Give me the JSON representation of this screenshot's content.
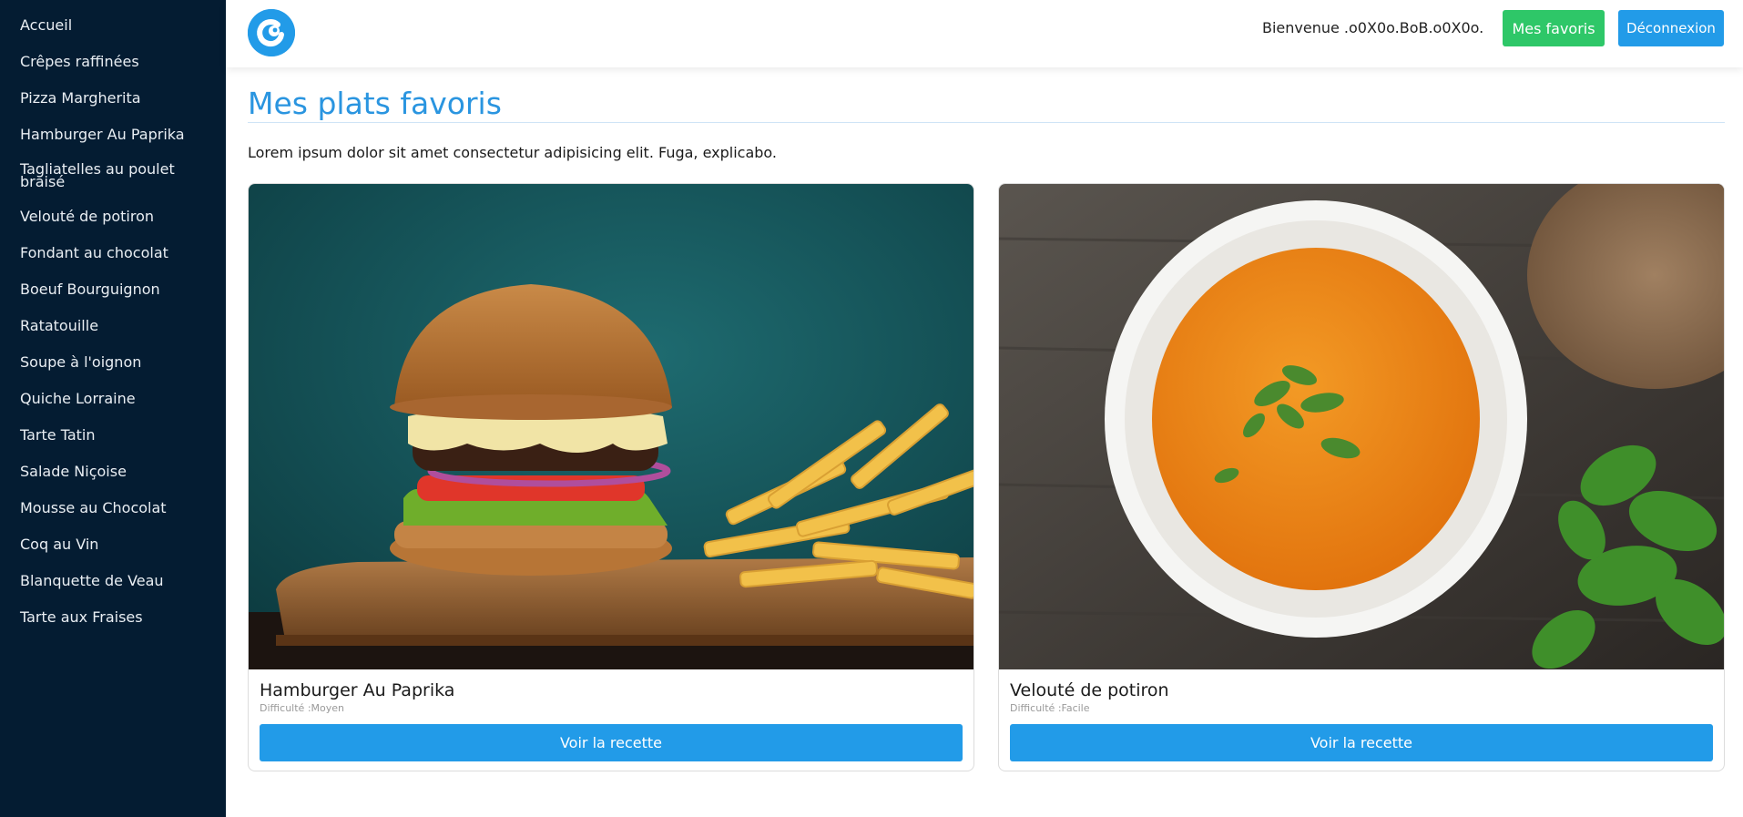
{
  "sidebar": {
    "items": [
      {
        "label": "Accueil"
      },
      {
        "label": "Crêpes raffinées"
      },
      {
        "label": "Pizza Margherita"
      },
      {
        "label": "Hamburger Au Paprika"
      },
      {
        "label": "Tagliatelles au poulet braisé"
      },
      {
        "label": "Velouté de potiron"
      },
      {
        "label": "Fondant au chocolat"
      },
      {
        "label": "Boeuf Bourguignon"
      },
      {
        "label": "Ratatouille"
      },
      {
        "label": "Soupe à l'oignon"
      },
      {
        "label": "Quiche Lorraine"
      },
      {
        "label": "Tarte Tatin"
      },
      {
        "label": "Salade Niçoise"
      },
      {
        "label": "Mousse au Chocolat"
      },
      {
        "label": "Coq au Vin"
      },
      {
        "label": "Blanquette de Veau"
      },
      {
        "label": "Tarte aux Fraises"
      }
    ]
  },
  "header": {
    "logo_icon": "cooking-logo-icon",
    "welcome": "Bienvenue .o0X0o.BoB.o0X0o.",
    "favorites_label": "Mes favoris",
    "logout_label": "Déconnexion"
  },
  "main": {
    "title": "Mes plats favoris",
    "intro": "Lorem ipsum dolor sit amet consectetur adipisicing elit. Fuga, explicabo.",
    "cards": [
      {
        "title": "Hamburger Au Paprika",
        "difficulty": "Difficulté :Moyen",
        "button_label": "Voir la recette",
        "image": "hamburger-photo"
      },
      {
        "title": "Velouté de potiron",
        "difficulty": "Difficulté :Facile",
        "button_label": "Voir la recette",
        "image": "soup-photo"
      }
    ]
  },
  "colors": {
    "sidebar_bg": "#041c32",
    "accent_blue": "#229be8",
    "favorites_green": "#2ec768"
  }
}
